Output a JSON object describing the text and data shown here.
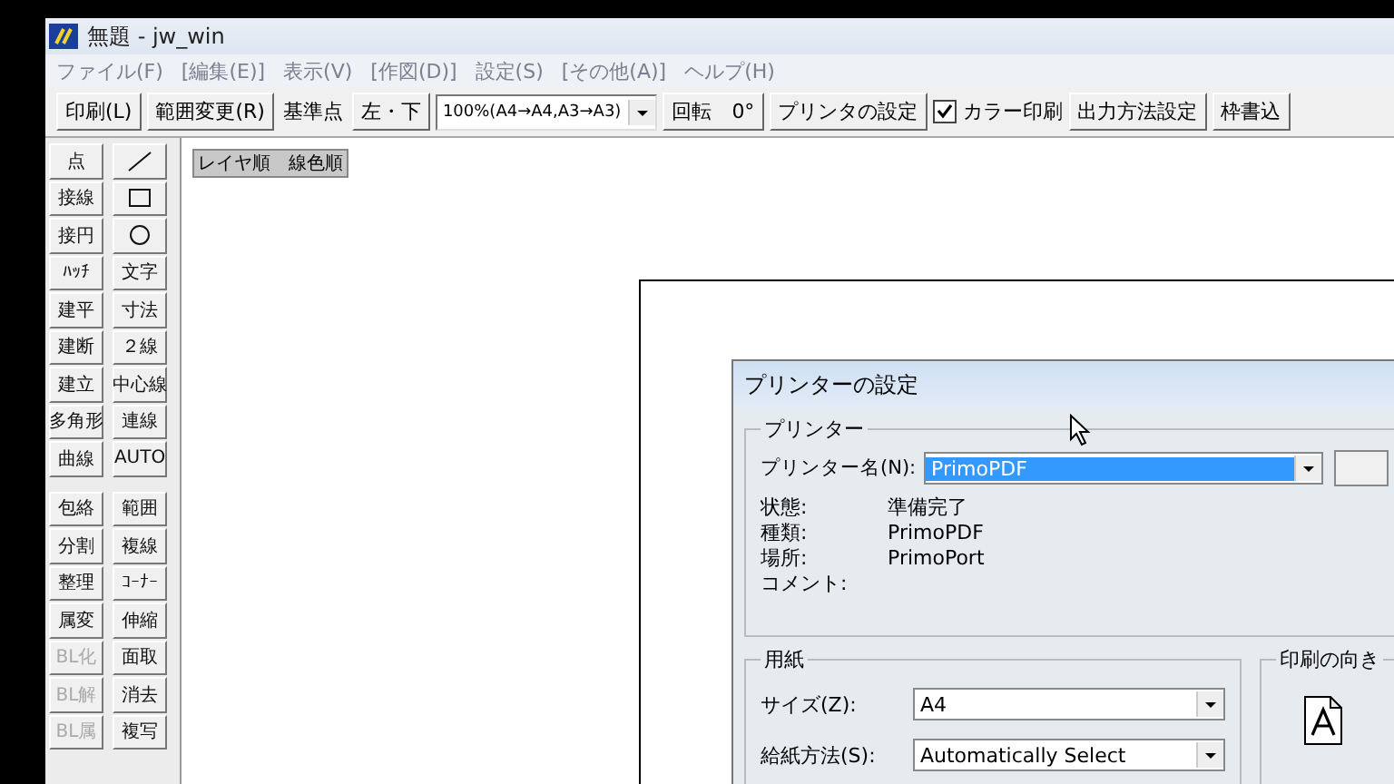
{
  "window": {
    "title": "無題 - jw_win"
  },
  "menu": [
    "ファイル(F)",
    "[編集(E)]",
    "表示(V)",
    "[作図(D)]",
    "設定(S)",
    "[その他(A)]",
    "ヘルプ(H)"
  ],
  "toolbar": [
    {
      "kind": "button",
      "label": "印刷(L)"
    },
    {
      "kind": "button",
      "label": "範囲変更(R)"
    },
    {
      "kind": "label",
      "label": "基準点"
    },
    {
      "kind": "button",
      "label": "左・下"
    },
    {
      "kind": "combo",
      "value": "100%(A4→A4,A3→A3)"
    },
    {
      "kind": "button",
      "label": "回転　0°"
    },
    {
      "kind": "button",
      "label": "プリンタの設定"
    },
    {
      "kind": "checkbox",
      "label": "カラー印刷",
      "checked": true
    },
    {
      "kind": "button",
      "label": "出力方法設定"
    },
    {
      "kind": "button",
      "label": "枠書込"
    }
  ],
  "layer_order_label": "レイヤ順　線色順",
  "tools": {
    "left": [
      [
        {
          "kind": "text",
          "label": "点",
          "disabled": false
        },
        {
          "kind": "text",
          "label": "接線",
          "disabled": false
        },
        {
          "kind": "text",
          "label": "接円",
          "disabled": false
        },
        {
          "kind": "text",
          "label": "ﾊｯﾁ",
          "disabled": false
        },
        {
          "kind": "text",
          "label": "建平",
          "disabled": false
        },
        {
          "kind": "text",
          "label": "建断",
          "disabled": false
        },
        {
          "kind": "text",
          "label": "建立",
          "disabled": false
        },
        {
          "kind": "text",
          "label": "多角形",
          "disabled": false
        },
        {
          "kind": "text",
          "label": "曲線",
          "disabled": false
        }
      ],
      [
        {
          "kind": "text",
          "label": "包絡",
          "disabled": false
        },
        {
          "kind": "text",
          "label": "分割",
          "disabled": false
        },
        {
          "kind": "text",
          "label": "整理",
          "disabled": false
        },
        {
          "kind": "text",
          "label": "属変",
          "disabled": false
        },
        {
          "kind": "text",
          "label": "BL化",
          "disabled": true
        },
        {
          "kind": "text",
          "label": "BL解",
          "disabled": true
        },
        {
          "kind": "text",
          "label": "BL属",
          "disabled": true
        }
      ]
    ],
    "right": [
      [
        {
          "kind": "line",
          "disabled": false
        },
        {
          "kind": "rect",
          "disabled": false
        },
        {
          "kind": "circle",
          "disabled": false
        },
        {
          "kind": "text",
          "label": "文字",
          "disabled": false
        },
        {
          "kind": "text",
          "label": "寸法",
          "disabled": false
        },
        {
          "kind": "text",
          "label": "２線",
          "disabled": false
        },
        {
          "kind": "text",
          "label": "中心線",
          "disabled": false
        },
        {
          "kind": "text",
          "label": "連線",
          "disabled": false
        },
        {
          "kind": "text",
          "label": "AUTO",
          "disabled": false
        }
      ],
      [
        {
          "kind": "text",
          "label": "範囲",
          "disabled": false
        },
        {
          "kind": "text",
          "label": "複線",
          "disabled": false
        },
        {
          "kind": "text",
          "label": "ｺｰﾅｰ",
          "disabled": false
        },
        {
          "kind": "text",
          "label": "伸縮",
          "disabled": false
        },
        {
          "kind": "text",
          "label": "面取",
          "disabled": false
        },
        {
          "kind": "text",
          "label": "消去",
          "disabled": false
        },
        {
          "kind": "text",
          "label": "複写",
          "disabled": false
        }
      ]
    ]
  },
  "dialog": {
    "title": "プリンターの設定",
    "printer_group": {
      "title": "プリンター",
      "name_label": "プリンター名(N):",
      "name_value": "PrimoPDF",
      "info": [
        {
          "label": "状態:",
          "value": "準備完了"
        },
        {
          "label": "種類:",
          "value": "PrimoPDF"
        },
        {
          "label": "場所:",
          "value": "PrimoPort"
        },
        {
          "label": "コメント:"
        }
      ]
    },
    "paper_group": {
      "title": "用紙",
      "fields": [
        {
          "label": "サイズ(Z):",
          "value": "A4"
        },
        {
          "label": "給紙方法(S):",
          "value": "Automatically Select"
        }
      ]
    },
    "orientation_group": {
      "title": "印刷の向き"
    }
  }
}
